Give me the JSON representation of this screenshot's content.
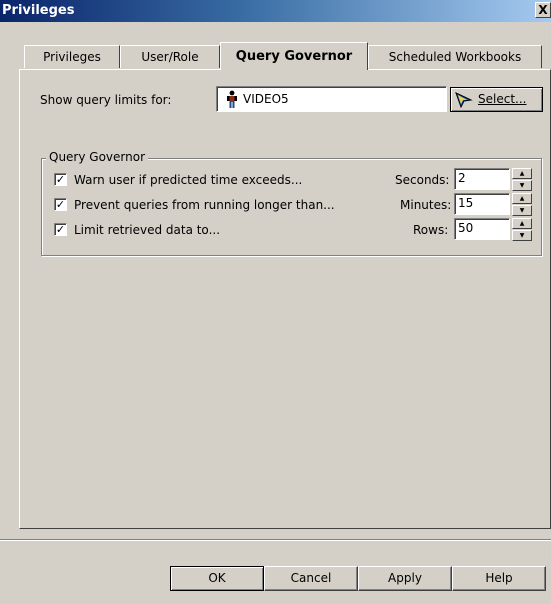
{
  "window": {
    "title": "Privileges",
    "close_glyph": "X"
  },
  "tabs": [
    {
      "label": "Privileges",
      "active": false
    },
    {
      "label": "User/Role",
      "active": false
    },
    {
      "label": "Query Governor",
      "active": true
    },
    {
      "label": "Scheduled Workbooks",
      "active": false
    }
  ],
  "show_limits": {
    "label": "Show query limits for:",
    "user_value": "VIDEO5",
    "user_icon": "person-icon",
    "select_button": "Select...",
    "select_icon": "pointer-arrow-icon"
  },
  "query_governor": {
    "group_label": "Query Governor",
    "rows": [
      {
        "label": "Warn user if predicted time exceeds...",
        "checked": true,
        "unit": "Seconds:",
        "value": "2"
      },
      {
        "label": "Prevent queries from running longer than...",
        "checked": true,
        "unit": "Minutes:",
        "value": "15"
      },
      {
        "label": "Limit retrieved data to...",
        "checked": true,
        "unit": "Rows:",
        "value": "50"
      }
    ]
  },
  "buttons": {
    "ok": "OK",
    "cancel": "Cancel",
    "apply": "Apply",
    "help": "Help"
  },
  "colors": {
    "face": "#d4d0c8",
    "title_start": "#0a246a",
    "title_end": "#a6caf0"
  }
}
